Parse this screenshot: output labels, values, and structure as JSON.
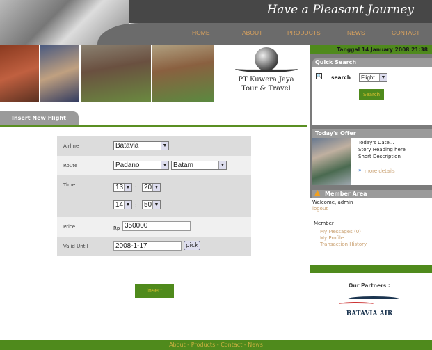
{
  "header": {
    "title": "Have a Pleasant Journey",
    "nav": [
      "HOME",
      "ABOUT",
      "PRODUCTS",
      "NEWS",
      "CONTACT"
    ]
  },
  "logo": {
    "line1": "PT Kuwera Jaya",
    "line2": "Tour & Travel"
  },
  "tab": {
    "label": "Insert New Flight"
  },
  "form": {
    "airline": {
      "label": "Airline",
      "value": "Batavia"
    },
    "route": {
      "label": "Route",
      "from": "Padano",
      "to": "Batam"
    },
    "time": {
      "label": "Time",
      "depart_hour": "13",
      "depart_min": "20",
      "arrive_hour": "14",
      "arrive_min": "50",
      "sep": ":"
    },
    "price": {
      "label": "Price",
      "currency": "Rp",
      "value": "350000"
    },
    "valid": {
      "label": "Valid Until",
      "value": "2008-1-17",
      "pick": "pick"
    },
    "insert": "Insert"
  },
  "sidebar": {
    "date": "Tanggal 14 January 2008 21:38",
    "quick_search": {
      "title": "Quick Search",
      "label": "search",
      "option": "Flight",
      "button": "Search"
    },
    "offer": {
      "title": "Today's Offer",
      "date": "Today's Date...",
      "heading": "Story Heading here",
      "desc": "Short Description",
      "more": "more details"
    },
    "member": {
      "title": "Member  Area",
      "welcome": "Welcome, admin",
      "logout": "logout",
      "section": "Member",
      "links": [
        "My Messages (0)",
        "My Profile",
        "Transaction History"
      ]
    },
    "partners": {
      "title": "Our Partners :",
      "logo_text": "BATAVIA AIR"
    }
  },
  "footer": {
    "links": "About - Products - Contact - News"
  },
  "colors": {
    "green": "#4f8a1c",
    "nav_link": "#d9a25e",
    "gray": "#7b7b7b"
  }
}
